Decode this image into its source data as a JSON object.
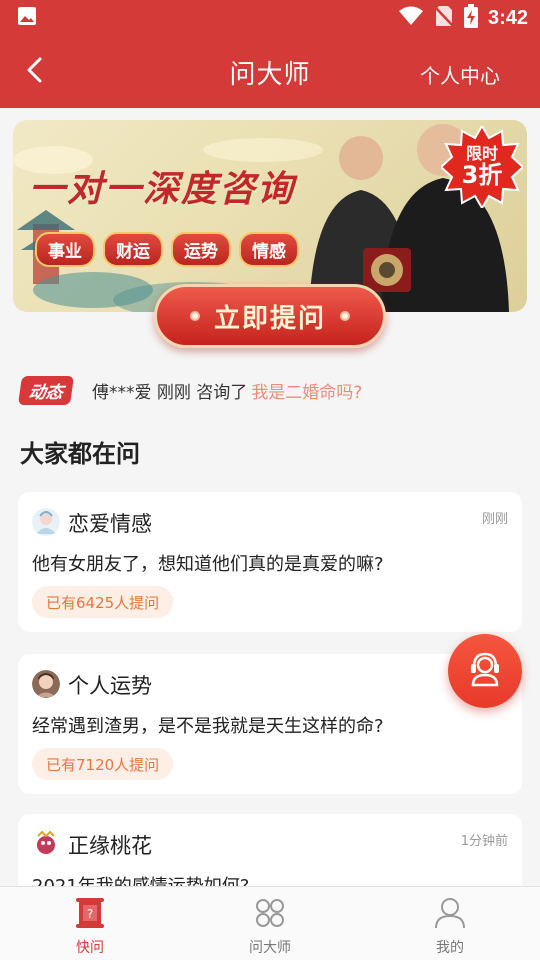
{
  "status_bar": {
    "time": "3:42",
    "icons": [
      "image-icon",
      "wifi-icon",
      "no-sim-icon",
      "battery-charging-icon"
    ]
  },
  "header": {
    "title": "问大师",
    "right_link": "个人中心",
    "back_icon": "chevron-left-icon"
  },
  "banner": {
    "title": "一对一深度咨询",
    "tags": [
      "事业",
      "财运",
      "运势",
      "情感"
    ],
    "discount_line1": "限时",
    "discount_line2": "3折",
    "cta_label": "立即提问"
  },
  "dynamic": {
    "badge": "动态",
    "text": "傅***爱 刚刚 咨询了",
    "link": "我是二婚命吗?"
  },
  "section_title": "大家都在问",
  "cards": [
    {
      "category": "恋爱情感",
      "time": "刚刚",
      "question": "他有女朋友了，想知道他们真的是真爱的嘛?",
      "count": "已有6425人提问"
    },
    {
      "category": "个人运势",
      "time": "",
      "question": "经常遇到渣男，是不是我就是天生这样的命?",
      "count": "已有7120人提问"
    },
    {
      "category": "正缘桃花",
      "time": "1分钟前",
      "question": "2021年我的感情运势如何?",
      "count": ""
    }
  ],
  "tabs": [
    {
      "label": "快问",
      "icon": "scroll-icon",
      "active": true
    },
    {
      "label": "问大师",
      "icon": "grid-icon",
      "active": false
    },
    {
      "label": "我的",
      "icon": "person-icon",
      "active": false
    }
  ],
  "colors": {
    "primary": "#d33a38",
    "accent_orange": "#e8763e",
    "link_pink": "#f08b7a"
  }
}
